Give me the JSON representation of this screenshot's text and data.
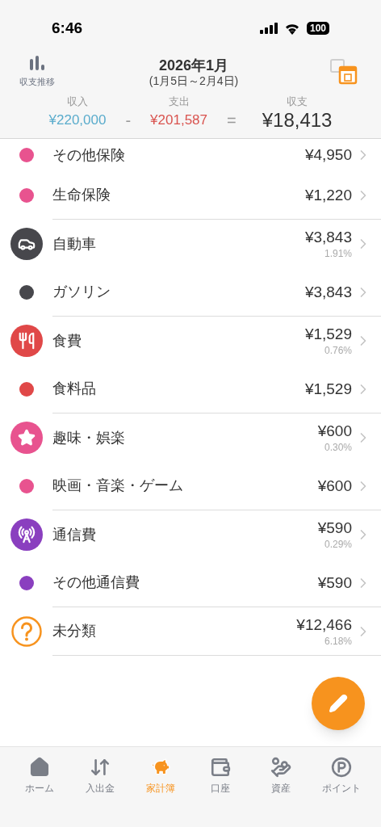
{
  "status_bar": {
    "time": "6:46",
    "battery": "100"
  },
  "header": {
    "trend_label": "収支推移",
    "month": "2026年1月",
    "period": "(1月5日～2月4日)"
  },
  "summary": [
    {
      "kind": "income",
      "label": "収入",
      "value": "¥220,000"
    },
    {
      "kind": "operator",
      "value": "-"
    },
    {
      "kind": "expense",
      "label": "支出",
      "value": "¥201,587"
    },
    {
      "kind": "operator",
      "value": "="
    },
    {
      "kind": "balance",
      "label": "収支",
      "value": "¥18,413"
    }
  ],
  "rows": [
    {
      "kind": "sub",
      "name": "その他保険",
      "amount": "¥4,950",
      "color": "#e8538f"
    },
    {
      "kind": "sub",
      "name": "生命保険",
      "amount": "¥1,220",
      "color": "#e8538f"
    },
    {
      "kind": "category",
      "name": "自動車",
      "amount": "¥3,843",
      "percent": "1.91%",
      "color": "#47474c"
    },
    {
      "kind": "sub",
      "name": "ガソリン",
      "amount": "¥3,843",
      "color": "#47474c"
    },
    {
      "kind": "category",
      "name": "食費",
      "amount": "¥1,529",
      "percent": "0.76%",
      "color": "#e04848"
    },
    {
      "kind": "sub",
      "name": "食料品",
      "amount": "¥1,529",
      "color": "#e04848"
    },
    {
      "kind": "category",
      "name": "趣味・娯楽",
      "amount": "¥600",
      "percent": "0.30%",
      "color": "#e8538f"
    },
    {
      "kind": "sub",
      "name": "映画・音楽・ゲーム",
      "amount": "¥600",
      "color": "#e8538f"
    },
    {
      "kind": "category",
      "name": "通信費",
      "amount": "¥590",
      "percent": "0.29%",
      "color": "#8a3fbf"
    },
    {
      "kind": "sub",
      "name": "その他通信費",
      "amount": "¥590",
      "color": "#8a3fbf"
    },
    {
      "kind": "category",
      "name": "未分類",
      "amount": "¥12,466",
      "percent": "6.18%",
      "color": "#f7931e"
    }
  ],
  "tabs": [
    {
      "label": "ホーム",
      "selected": false
    },
    {
      "label": "入出金",
      "selected": false
    },
    {
      "label": "家計簿",
      "selected": true
    },
    {
      "label": "口座",
      "selected": false
    },
    {
      "label": "資産",
      "selected": false
    },
    {
      "label": "ポイント",
      "selected": false
    }
  ]
}
